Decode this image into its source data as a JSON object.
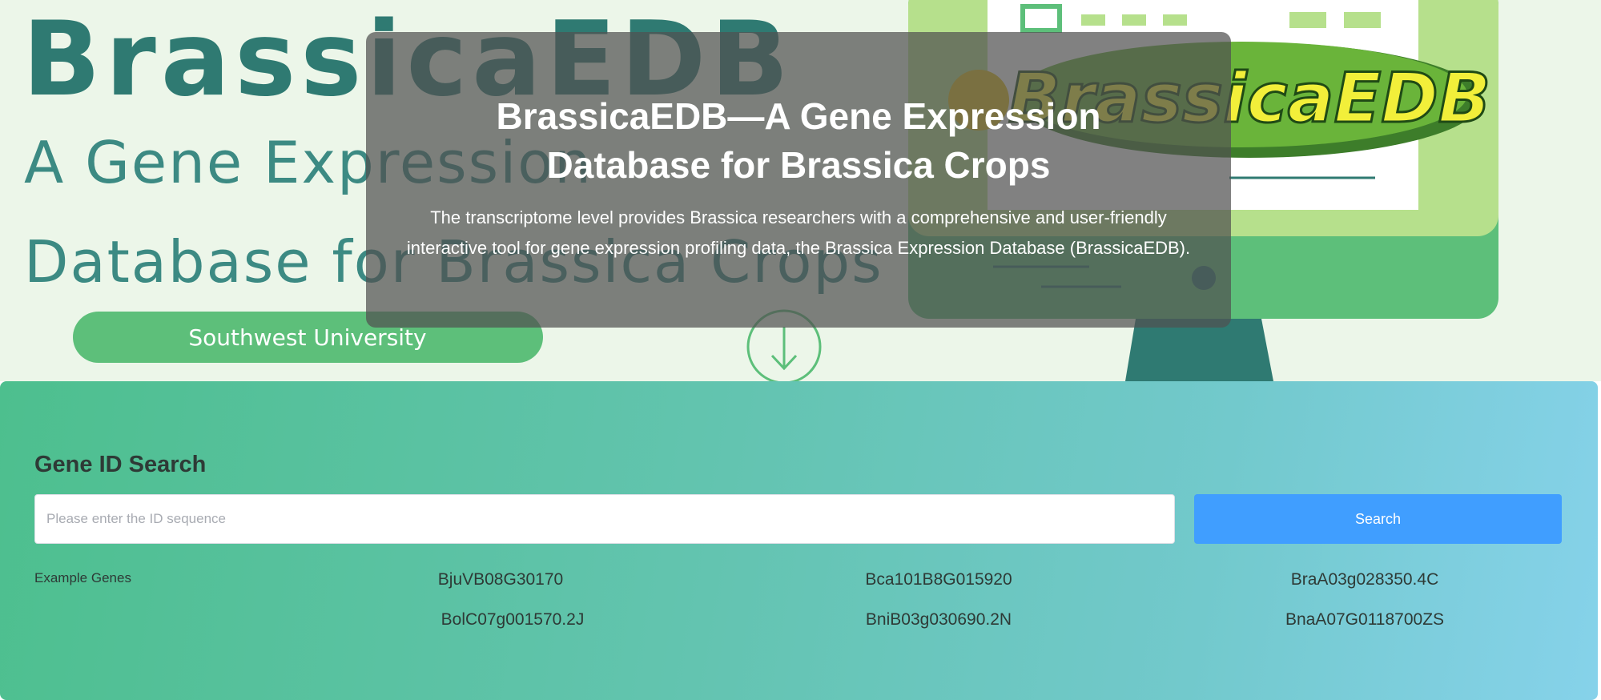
{
  "hero": {
    "banner_logo": "BrassicaEDB",
    "banner_subtitle_line1": "A Gene Expression",
    "banner_subtitle_line2": "Database for Brassica Crops",
    "banner_university": "Southwest University",
    "monitor_logo": "BrassicaEDB",
    "title": "BrassicaEDB—A Gene Expression Database for Brassica Crops",
    "description": "The transcriptome level provides Brassica researchers with a comprehensive and user-friendly interactive tool for gene expression profiling data, the Brassica Expression Database (BrassicaEDB).",
    "scroll_icon": "arrow-down-circle-icon"
  },
  "search": {
    "title": "Gene ID Search",
    "placeholder": "Please enter the ID sequence",
    "value": "",
    "button_label": "Search",
    "examples_label": "Example Genes",
    "example_genes": [
      "BjuVB08G30170",
      "Bca101B8G015920",
      "BraA03g028350.4C",
      "BolC07g001570.2J",
      "BniB03g030690.2N",
      "BnaA07G0118700ZS"
    ]
  },
  "colors": {
    "banner_bg": "#ecf6e9",
    "banner_teal": "#2f7a72",
    "banner_green": "#5dbf7a",
    "button_blue": "#409eff",
    "gradient_start": "#4dbf8e",
    "gradient_end": "#86d2ea"
  }
}
